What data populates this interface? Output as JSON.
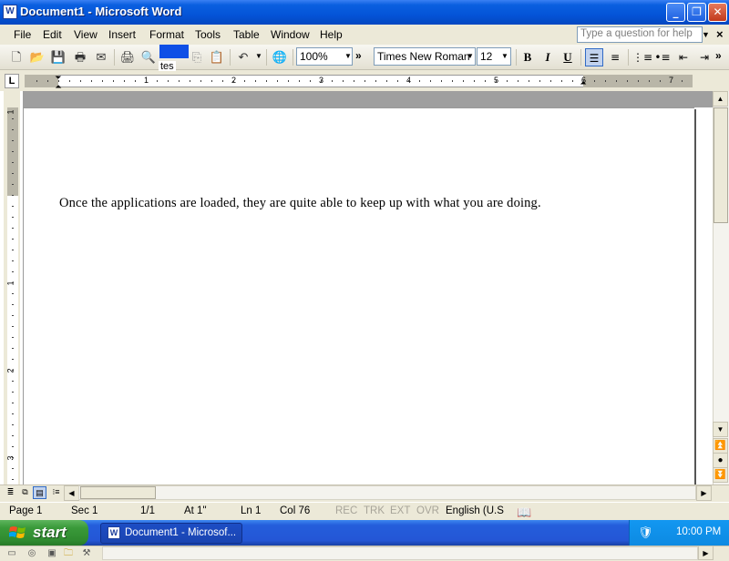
{
  "window": {
    "title": "Document1 - Microsoft Word",
    "app_icon": "W",
    "buttons": {
      "minimize": "_",
      "maximize": "❐",
      "close": "✕"
    }
  },
  "menu": {
    "items": [
      "File",
      "Edit",
      "View",
      "Insert",
      "Format",
      "Tools",
      "Table",
      "Window",
      "Help"
    ],
    "ask_placeholder": "Type a question for help"
  },
  "toolbar": {
    "zoom": "100%",
    "font": "Times New Roman",
    "font_size": "12",
    "bold": "B",
    "italic": "I",
    "underline": "U",
    "partial_label": "tes"
  },
  "ruler": {
    "numbers": [
      "1",
      "2",
      "3",
      "4",
      "5",
      "6",
      "7"
    ],
    "vertical_numbers": [
      "1",
      "1",
      "2",
      "3"
    ]
  },
  "document": {
    "text": "Once the applications are loaded, they are quite able to keep up with what you are doing."
  },
  "statusbar": {
    "page": "Page  1",
    "sec": "Sec  1",
    "pages": "1/1",
    "at": "At  1\"",
    "ln": "Ln  1",
    "col": "Col  76",
    "rec": "REC",
    "trk": "TRK",
    "ext": "EXT",
    "ovr": "OVR",
    "language": "English (U.S"
  },
  "taskbar": {
    "start": "start",
    "task_label": "Document1 - Microsof...",
    "clock": "10:00 PM"
  },
  "colors": {
    "titlebar": "#0454d8",
    "taskbar": "#245edb",
    "start": "#3a9a3a",
    "chrome": "#ece9d8"
  }
}
